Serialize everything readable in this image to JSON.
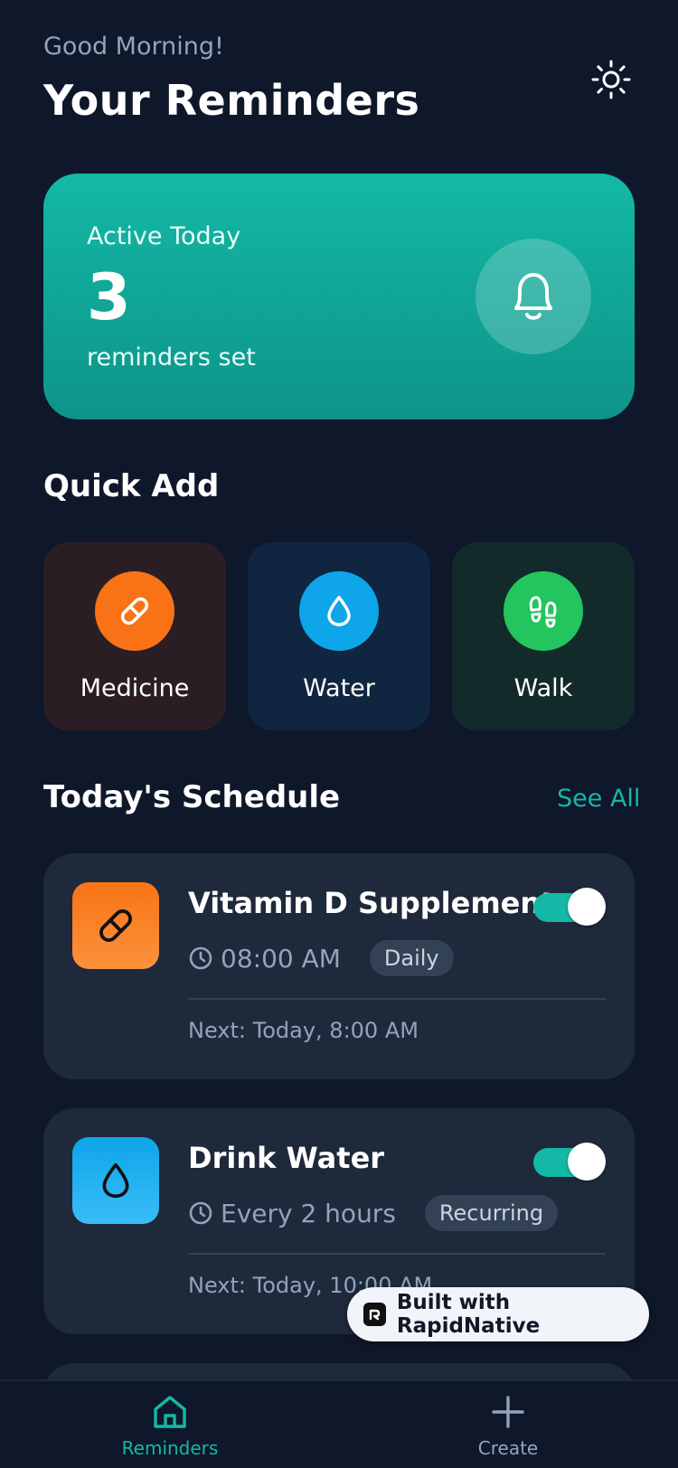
{
  "header": {
    "greeting": "Good Morning!",
    "title": "Your Reminders",
    "theme_icon": "sun-icon"
  },
  "active_card": {
    "label": "Active Today",
    "count": "3",
    "subtitle": "reminders set",
    "icon": "bell-icon"
  },
  "quick_add": {
    "title": "Quick Add",
    "items": [
      {
        "label": "Medicine",
        "icon": "pill-icon",
        "color": "#f97316",
        "bg": "#2a1e24"
      },
      {
        "label": "Water",
        "icon": "droplet-icon",
        "color": "#0ea5e9",
        "bg": "#0f2540"
      },
      {
        "label": "Walk",
        "icon": "footprints-icon",
        "color": "#22c55e",
        "bg": "#132a2b"
      }
    ]
  },
  "schedule": {
    "title": "Today's Schedule",
    "see_all": "See All",
    "items": [
      {
        "title": "Vitamin D Supplement",
        "time": "08:00 AM",
        "badge": "Daily",
        "next": "Next: Today, 8:00 AM",
        "enabled": true,
        "icon": "pill-icon",
        "color": "#f97316"
      },
      {
        "title": "Drink Water",
        "time": "Every 2 hours",
        "badge": "Recurring",
        "next": "Next: Today, 10:00 AM",
        "enabled": true,
        "icon": "droplet-icon",
        "color": "#0ea5e9"
      }
    ]
  },
  "built_with": "Built with RapidNative",
  "tabbar": {
    "tabs": [
      {
        "label": "Reminders",
        "icon": "home-icon",
        "active": true
      },
      {
        "label": "Create",
        "icon": "plus-icon",
        "active": false
      }
    ]
  },
  "colors": {
    "background": "#0f172a",
    "card": "#1e293b",
    "accent": "#14b8a6",
    "muted": "#94a3b8"
  }
}
